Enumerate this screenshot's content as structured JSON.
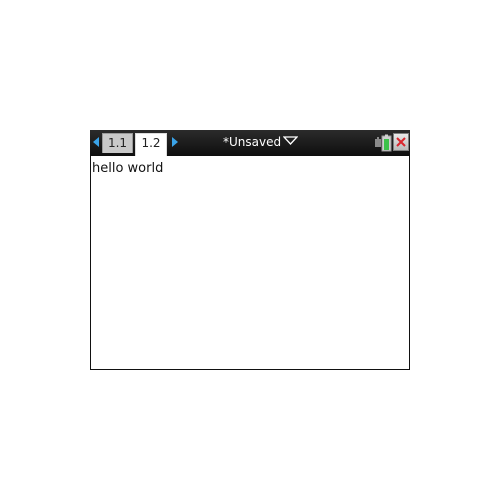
{
  "tabs": [
    {
      "label": "1.1"
    },
    {
      "label": "1.2"
    }
  ],
  "document": {
    "title": "*Unsaved"
  },
  "content": {
    "text": "hello world"
  },
  "icons": {
    "previous_page": "left-arrow-icon",
    "next_page": "right-arrow-icon",
    "document_menu": "dropdown-triangle-icon",
    "battery": "battery-icon",
    "close": "close-icon"
  },
  "colors": {
    "titlebar": "#111111",
    "nav_arrow": "#3aa3e8",
    "battery_charge": "#3cc24a",
    "close_x": "#d9262e"
  }
}
